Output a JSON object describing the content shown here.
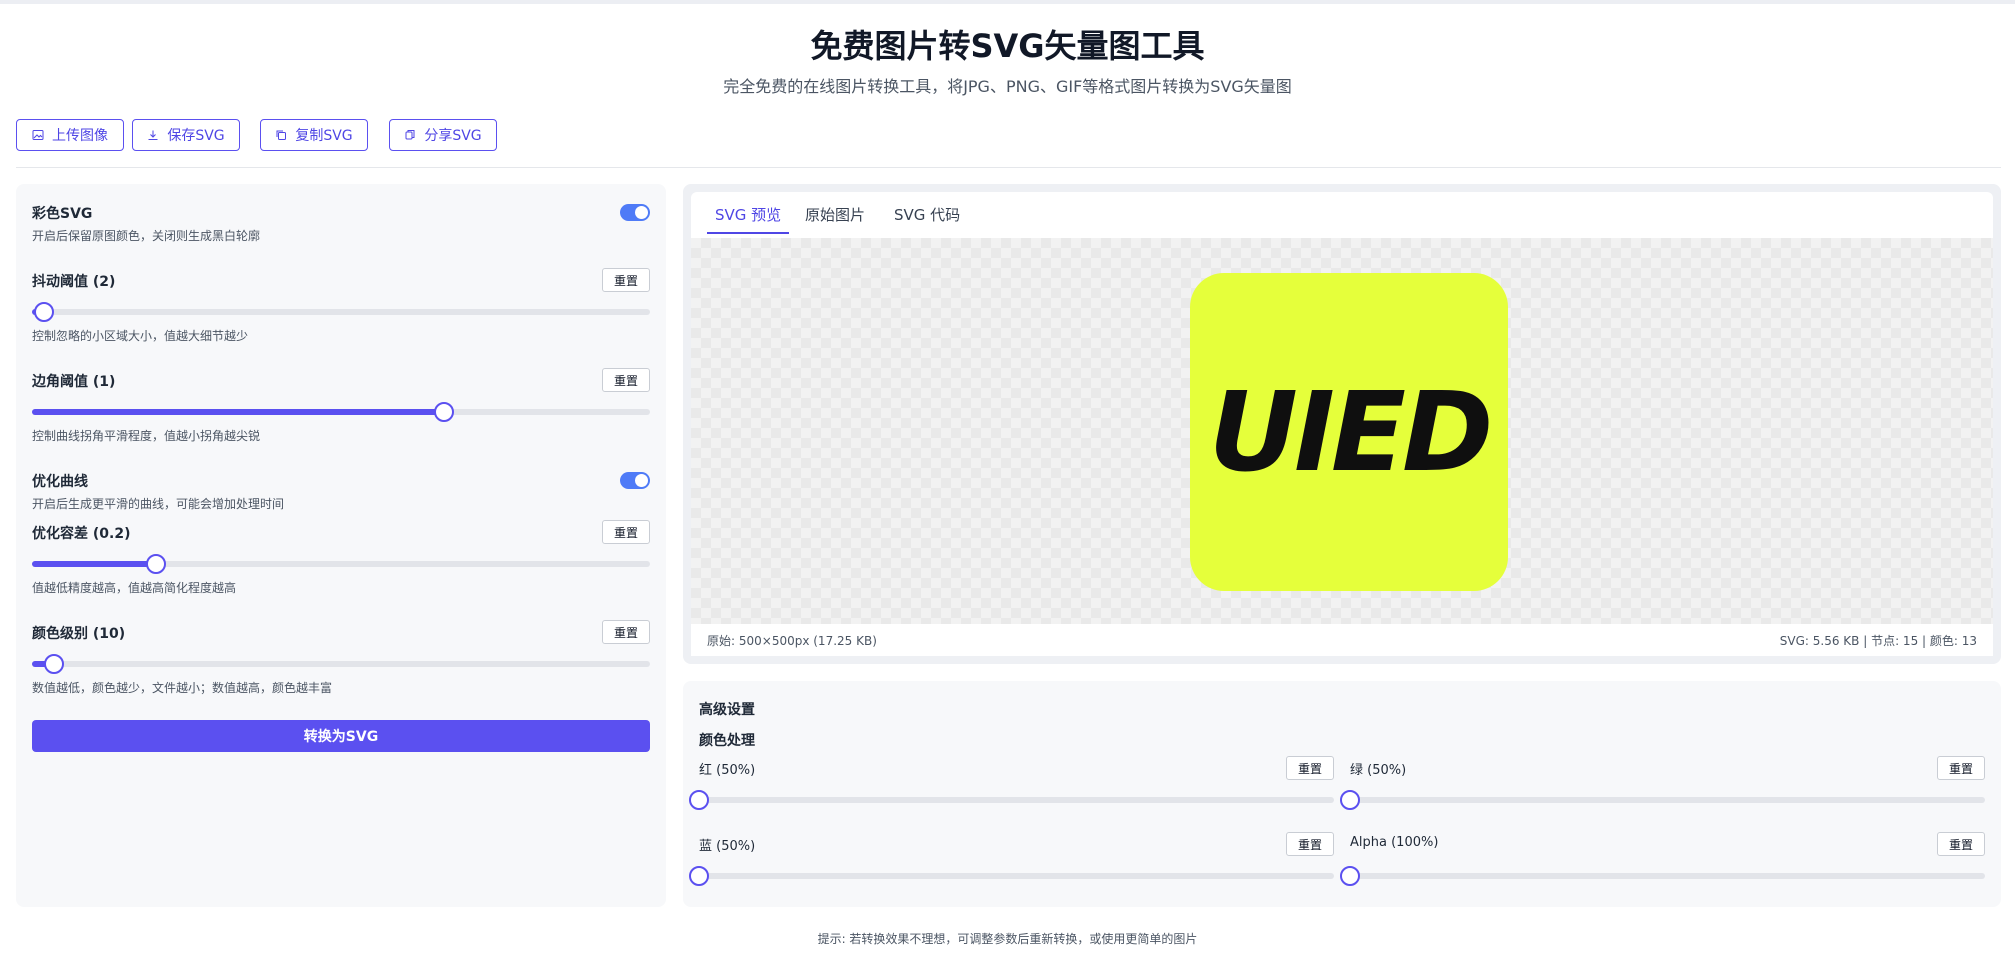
{
  "header": {
    "title": "免费图片转SVG矢量图工具",
    "subtitle": "完全免费的在线图片转换工具，将JPG、PNG、GIF等格式图片转换为SVG矢量图"
  },
  "toolbar": {
    "upload": "上传图像",
    "save": "保存SVG",
    "copy": "复制SVG",
    "share": "分享SVG"
  },
  "settings": {
    "color_svg": {
      "label": "彩色SVG",
      "desc": "开启后保留原图颜色，关闭则生成黑白轮廓",
      "enabled": true
    },
    "jitter": {
      "label": "抖动阈值 (2)",
      "desc": "控制忽略的小区域大小，值越大细节越少",
      "value_fraction": 0.02
    },
    "corner": {
      "label": "边角阈值 (1)",
      "desc": "控制曲线拐角平滑程度，值越小拐角越尖锐",
      "value_fraction": 0.667
    },
    "optimize_curve": {
      "label": "优化曲线",
      "desc": "开启后生成更平滑的曲线，可能会增加处理时间",
      "enabled": true
    },
    "tolerance": {
      "label": "优化容差 (0.2)",
      "desc": "值越低精度越高，值越高简化程度越高",
      "value_fraction": 0.2
    },
    "color_levels": {
      "label": "颜色级别 (10)",
      "desc": "数值越低，颜色越少，文件越小；数值越高，颜色越丰富",
      "value_fraction": 0.035
    },
    "reset": "重置",
    "convert": "转换为SVG"
  },
  "preview": {
    "tabs": [
      "SVG 预览",
      "原始图片",
      "SVG 代码"
    ],
    "active_tab": 0,
    "logo_text": "UIED",
    "logo_color": "#e5ff3b",
    "status_left": "原始: 500×500px (17.25 KB)",
    "status_right": "SVG: 5.56 KB | 节点: 15 | 颜色: 13"
  },
  "advanced": {
    "title": "高级设置",
    "subtitle": "颜色处理",
    "red": "红 (50%)",
    "green": "绿 (50%)",
    "blue": "蓝 (50%)",
    "alpha": "Alpha (100%)",
    "reset": "重置"
  },
  "hint": "提示: 若转换效果不理想，可调整参数后重新转换，或使用更简单的图片",
  "colors": {
    "accent": "#5b50f0",
    "toggle": "#4f7bf7"
  }
}
